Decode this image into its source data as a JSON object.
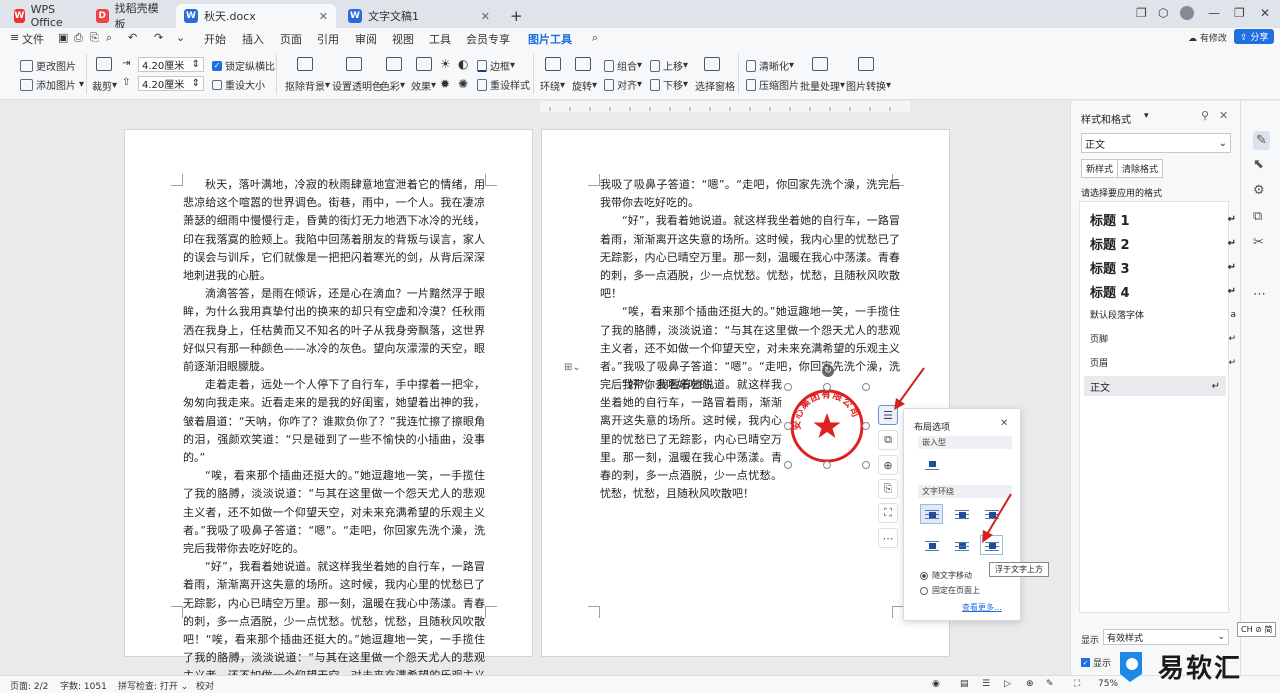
{
  "titlebar": {
    "app_tab": "WPS Office",
    "template_tab": "找稻壳模板",
    "doc_tab": "秋天.docx",
    "doc2_tab": "文字文稿1",
    "new_tab": "+"
  },
  "menubar": {
    "file": "文件",
    "tabs": [
      "开始",
      "插入",
      "页面",
      "引用",
      "审阅",
      "视图",
      "工具",
      "会员专享",
      "图片工具"
    ],
    "active_tab": "图片工具",
    "edit_status": "有修改",
    "share": "分享"
  },
  "ribbon": {
    "change_image": "更改图片",
    "add_image": "添加图片",
    "crop": "裁剪",
    "width_value": "4.20厘米",
    "height_value": "4.20厘米",
    "lock_ratio": "锁定纵横比",
    "reset_size": "重设大小",
    "remove_bg": "抠除背景",
    "set_transparent": "设置透明色",
    "color": "色彩",
    "effects": "效果",
    "border": "边框",
    "reset_style": "重设样式",
    "wrap": "环绕",
    "rotate": "旋转",
    "group": "组合",
    "align": "对齐",
    "bring_forward": "上移",
    "send_backward": "下移",
    "selection_pane": "选择窗格",
    "sharpen": "清晰化",
    "compress": "压缩图片",
    "batch": "批量处理",
    "convert": "图片转换"
  },
  "page1": {
    "paragraphs": [
      "秋天，落叶满地，冷寂的秋雨肆意地宣泄着它的情绪，用悲凉给这个喧嚣的世界调色。街巷，雨中，一个人。我在凄凉萧瑟的细雨中慢慢行走，昏黄的街灯无力地洒下冰冷的光线，印在我落寞的脸颊上。我陷中回荡着朋友的背叛与误言，家人的误会与训斥，它们就像是一把把闪着寒光的剑，从背后深深地刺进我的心脏。",
      "滴滴答答，是雨在倾诉，还是心在滴血？一片黯然浮于眼眸，为什么我用真挚付出的换来的却只有空虚和冷漠？任秋雨洒在我身上，任枯黄而又不知名的叶子从我身旁飘落，这世界好似只有那一种颜色——冰冷的灰色。望向灰濛濛的天空，眼前逐渐泪眼朦胧。",
      "走着走着，远处一个人停下了自行车，手中撑着一把伞，匆匆向我走来。近看走来的是我的好闺蜜，她望着出神的我，皱着眉道：“天呐，你咋了？谁欺负你了？”我连忙擦了擦眼角的泪，强颜欢笑道：“只是碰到了一些不愉快的小插曲，没事的。”",
      "“唉，看来那个插曲还挺大的。”她逗趣地一笑，一手揽住了我的胳膊，淡淡说道：“与其在这里做一个怨天尤人的悲观主义者，还不如做一个仰望天空，对未来充满希望的乐观主义者。”我吸了吸鼻子答道：“嗯”。“走吧，你回家先洗个澡，洗完后我带你去吃好吃的。",
      "“好”，我看着她说道。就这样我坐着她的自行车，一路冒着雨，渐渐离开这失意的场所。这时候，我内心里的忧愁已了无踪影，内心已晴空万里。那一刻，温暖在我心中荡漾。青春的刺，多一点酒脱，少一点忧愁。忧愁，忧愁，且随秋风吹散吧！“唉，看来那个插曲还挺大的。”她逗趣地一笑，一手揽住了我的胳膊，淡淡说道：“与其在这里做一个怨天尤人的悲观主义者，还不如做一个仰望天空，对未来充满希望的乐观主义者。"
    ]
  },
  "page2": {
    "first_line": "我吸了吸鼻子答道：“嗯”。“走吧，你回家先洗个澡，洗完后我带你去吃好吃的。",
    "paragraphs": [
      "“好”，我看着她说道。就这样我坐着她的自行车，一路冒着雨，渐渐离开这失意的场所。这时候，我内心里的忧愁已了无踪影，内心已晴空万里。那一刻，温暖在我心中荡漾。青春的刺，多一点酒脱，少一点忧愁。忧愁，忧愁，且随秋风吹散吧！",
      "“唉，看来那个插曲还挺大的。”她逗趣地一笑，一手揽住了我的胳膊，淡淡说道：“与其在这里做一个怨天尤人的悲观主义者，还不如做一个仰望天空，对未来充满希望的乐观主义者。”我吸了吸鼻子答道：“嗯”。“走吧，你回家先洗个澡，洗完后我带你去吃好吃的。",
      "“好”，我看着她说道。就这样我坐着她的自行车，一路冒着雨，渐渐离开这失意的场所。这时候，我内心里的忧愁已了无踪影，内心已晴空万里。那一刻，温暖在我心中荡漾。青春的刺，多一点酒脱，少一点忧愁。忧愁，忧愁，且随秋风吹散吧！"
    ]
  },
  "stamp": {
    "text": "安心集团有限公司",
    "color": "#e02020"
  },
  "layout_popup": {
    "title": "布局选项",
    "inline_section": "嵌入型",
    "wrap_section": "文字环绕",
    "move_with_text": "随文字移动",
    "fix_on_page": "固定在页面上",
    "see_more": "查看更多...",
    "tooltip": "浮于文字上方"
  },
  "right_panel": {
    "title": "样式和格式",
    "current_style": "正文",
    "new_style": "新样式",
    "clear_format": "清除格式",
    "apply_label": "请选择要应用的格式",
    "styles": [
      "标题 1",
      "标题 2",
      "标题 3",
      "标题 4",
      "默认段落字体",
      "页脚",
      "页眉",
      "正文"
    ],
    "show_label": "显示",
    "show_value": "有效样式",
    "show_preview": "显示"
  },
  "statusbar": {
    "page": "页面: 2/2",
    "words": "字数: 1051",
    "spell": "拼写检查: 打开",
    "proof": "校对",
    "zoom": "75%",
    "ime": "CH ⊘ 简"
  },
  "watermark": {
    "text": "易软汇"
  },
  "colors": {
    "accent": "#1f6fe0",
    "stamp_red": "#e02020",
    "arrow_red": "#d42020"
  }
}
